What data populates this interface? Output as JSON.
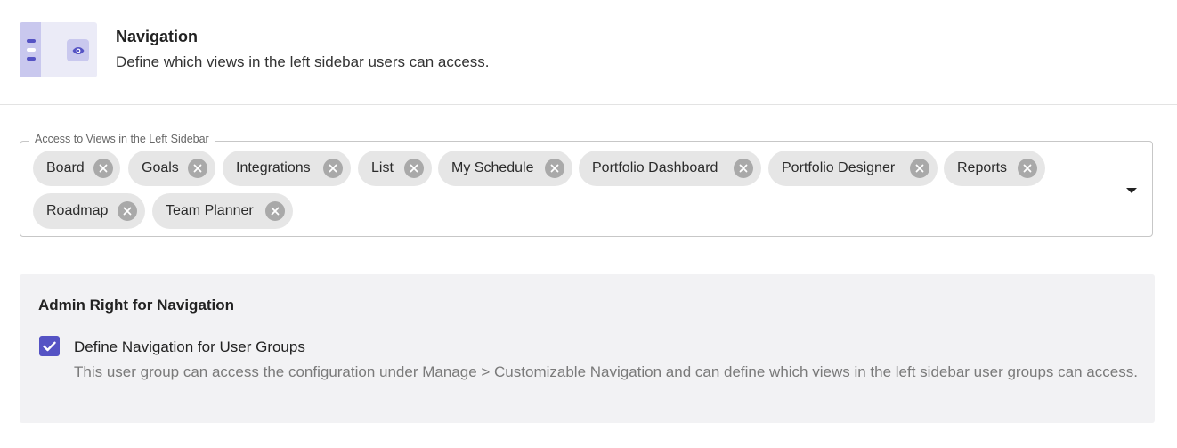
{
  "header": {
    "title": "Navigation",
    "subtitle": "Define which views in the left sidebar users can access.",
    "thumbnail_icon": "eye-icon"
  },
  "views_select": {
    "legend": "Access to Views in the Left Sidebar",
    "chips": [
      {
        "label": "Board"
      },
      {
        "label": "Goals"
      },
      {
        "label": "Integrations"
      },
      {
        "label": "List"
      },
      {
        "label": "My Schedule"
      },
      {
        "label": "Portfolio Dashboard"
      },
      {
        "label": "Portfolio Designer"
      },
      {
        "label": "Reports"
      },
      {
        "label": "Roadmap"
      },
      {
        "label": "Team Planner"
      }
    ],
    "remove_icon": "close-circle-icon",
    "dropdown_icon": "caret-down-icon"
  },
  "admin_panel": {
    "title": "Admin Right for Navigation",
    "checkbox_checked": true,
    "checkbox_label": "Define Navigation for User Groups",
    "checkbox_description": "This user group can access the configuration under Manage > Customizable Navigation and can define which views in the left sidebar user groups can access."
  },
  "colors": {
    "accent": "#5553c4",
    "accent_light": "#c9c8ee",
    "chip_bg": "#e6e6e6",
    "panel_bg": "#f2f2f4"
  }
}
